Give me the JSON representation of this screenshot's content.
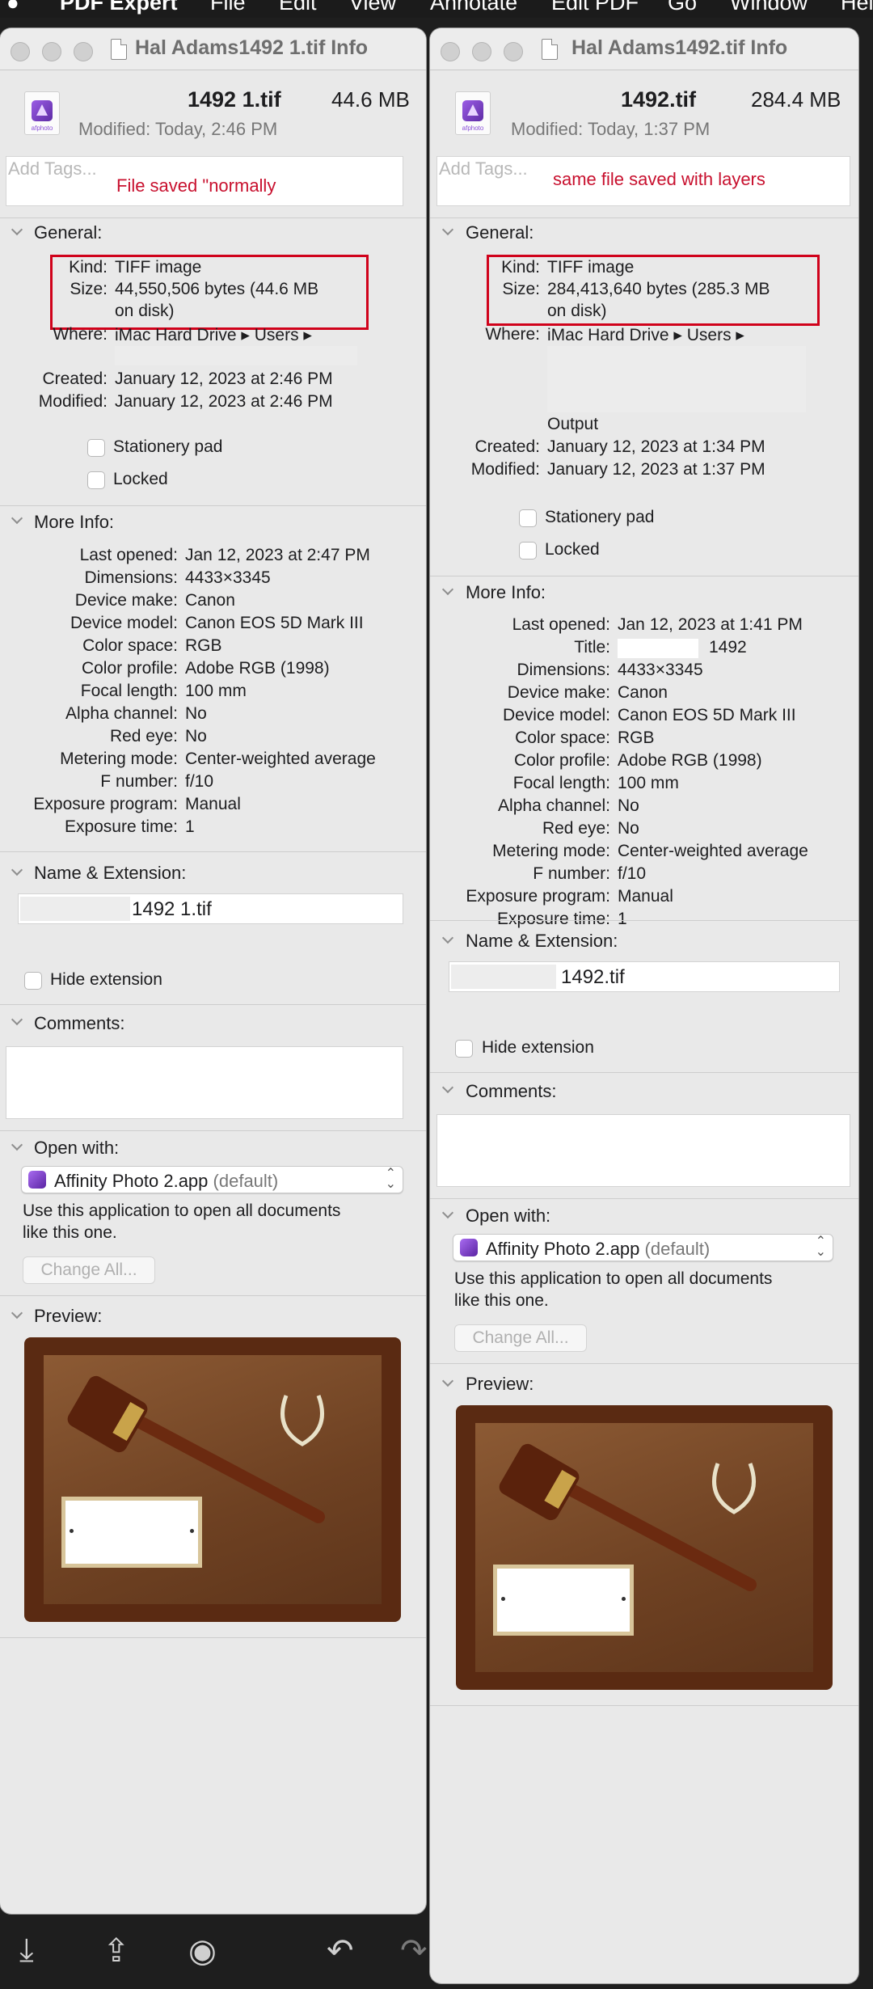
{
  "menubar": {
    "app_name": "PDF Expert",
    "items": [
      "File",
      "Edit",
      "View",
      "Annotate",
      "Edit PDF",
      "Go",
      "Window",
      "Help"
    ]
  },
  "left": {
    "title": "Hal Adams1492 1.tif Info",
    "file_name": "1492 1.tif",
    "file_size": "44.6 MB",
    "modified_header": "Modified:  Today, 2:46 PM",
    "file_icon_caption": "afphoto",
    "tags_placeholder": "Add Tags...",
    "tag_note": "File saved \"normally",
    "general": {
      "header": "General:",
      "kind_label": "Kind:",
      "kind": "TIFF image",
      "size_label": "Size:",
      "size_line1": "44,550,506 bytes (44.6 MB",
      "size_line2": "on disk)",
      "where_label": "Where:",
      "where": "iMac Hard Drive ▸ Users ▸",
      "created_label": "Created:",
      "created": "January 12, 2023 at 2:46 PM",
      "modified_label": "Modified:",
      "modified": "January 12, 2023 at 2:46 PM",
      "stationery": "Stationery pad",
      "locked": "Locked"
    },
    "more_info": {
      "header": "More Info:",
      "rows": [
        {
          "label": "Last opened:",
          "value": "Jan 12, 2023 at 2:47 PM"
        },
        {
          "label": "Dimensions:",
          "value": "4433×3345"
        },
        {
          "label": "Device make:",
          "value": "Canon"
        },
        {
          "label": "Device model:",
          "value": "Canon EOS 5D Mark III"
        },
        {
          "label": "Color space:",
          "value": "RGB"
        },
        {
          "label": "Color profile:",
          "value": "Adobe RGB (1998)"
        },
        {
          "label": "Focal length:",
          "value": "100 mm"
        },
        {
          "label": "Alpha channel:",
          "value": "No"
        },
        {
          "label": "Red eye:",
          "value": "No"
        },
        {
          "label": "Metering mode:",
          "value": "Center-weighted average"
        },
        {
          "label": "F number:",
          "value": "f/10"
        },
        {
          "label": "Exposure program:",
          "value": "Manual"
        },
        {
          "label": "Exposure time:",
          "value": "1"
        }
      ]
    },
    "name_ext": {
      "header": "Name & Extension:",
      "value": "1492 1.tif",
      "hide_ext": "Hide extension"
    },
    "comments": {
      "header": "Comments:"
    },
    "open_with": {
      "header": "Open with:",
      "app": "Affinity Photo 2.app",
      "default": "(default)",
      "note_line1": "Use this application to open all documents",
      "note_line2": "like this one.",
      "change_all": "Change All..."
    },
    "preview": {
      "header": "Preview:"
    }
  },
  "right": {
    "title": "Hal Adams1492.tif Info",
    "file_name": "1492.tif",
    "file_size": "284.4 MB",
    "modified_header": "Modified:  Today, 1:37 PM",
    "file_icon_caption": "afphoto",
    "tags_placeholder": "Add Tags...",
    "tag_note": "same file saved with layers",
    "general": {
      "header": "General:",
      "kind_label": "Kind:",
      "kind": "TIFF image",
      "size_label": "Size:",
      "size_line1": "284,413,640 bytes (285.3 MB",
      "size_line2": "on disk)",
      "where_label": "Where:",
      "where": "iMac Hard Drive ▸ Users ▸",
      "where_line3": "Output",
      "created_label": "Created:",
      "created": "January 12, 2023 at 1:34 PM",
      "modified_label": "Modified:",
      "modified": "January 12, 2023 at 1:37 PM",
      "stationery": "Stationery pad",
      "locked": "Locked"
    },
    "more_info": {
      "header": "More Info:",
      "rows": [
        {
          "label": "Last opened:",
          "value": "Jan 12, 2023 at 1:41 PM"
        },
        {
          "label": "Title:",
          "value": "1492"
        },
        {
          "label": "Dimensions:",
          "value": "4433×3345"
        },
        {
          "label": "Device make:",
          "value": "Canon"
        },
        {
          "label": "Device model:",
          "value": "Canon EOS 5D Mark III"
        },
        {
          "label": "Color space:",
          "value": "RGB"
        },
        {
          "label": "Color profile:",
          "value": "Adobe RGB (1998)"
        },
        {
          "label": "Focal length:",
          "value": "100 mm"
        },
        {
          "label": "Alpha channel:",
          "value": "No"
        },
        {
          "label": "Red eye:",
          "value": "No"
        },
        {
          "label": "Metering mode:",
          "value": "Center-weighted average"
        },
        {
          "label": "F number:",
          "value": "f/10"
        },
        {
          "label": "Exposure program:",
          "value": "Manual"
        },
        {
          "label": "Exposure time:",
          "value": "1"
        }
      ]
    },
    "name_ext": {
      "header": "Name & Extension:",
      "value": "1492.tif",
      "hide_ext": "Hide extension"
    },
    "comments": {
      "header": "Comments:"
    },
    "open_with": {
      "header": "Open with:",
      "app": "Affinity Photo 2.app",
      "default": "(default)",
      "note_line1": "Use this application to open all documents",
      "note_line2": "like this one.",
      "change_all": "Change All..."
    },
    "preview": {
      "header": "Preview:"
    }
  },
  "colors": {
    "annotation_red": "#d0021b",
    "window_bg": "#e9e9e9"
  },
  "icons": [
    "download-icon",
    "share-icon",
    "camera-icon",
    "undo-icon",
    "redo-icon"
  ]
}
